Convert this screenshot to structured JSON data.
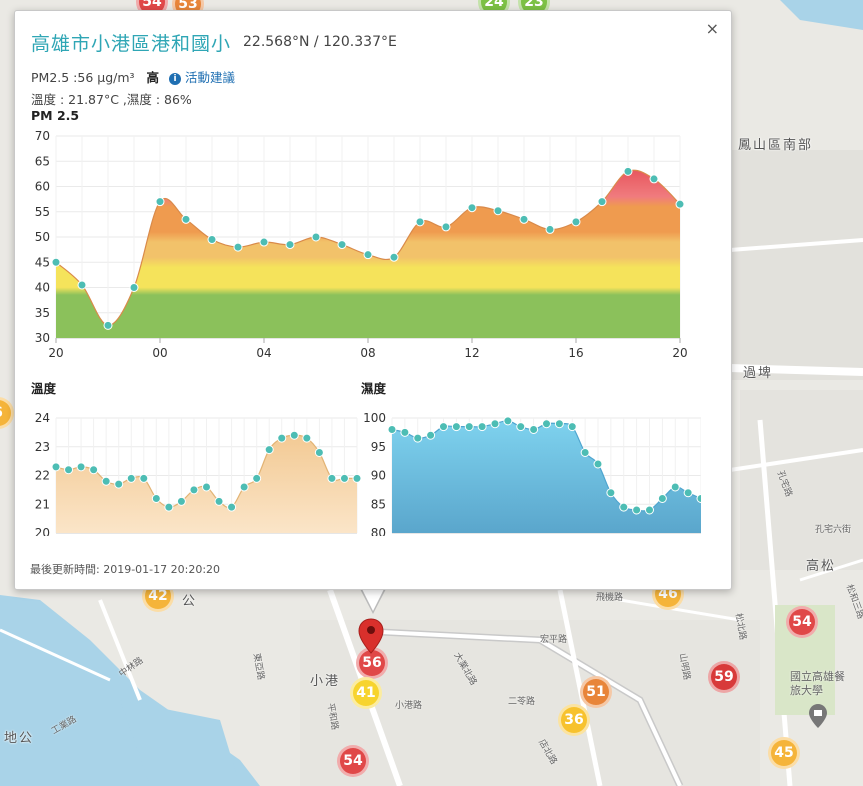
{
  "popup": {
    "close_label": "×",
    "station_name": "高雄市小港區港和國小",
    "coords": "22.568°N / 120.337°E",
    "pm_text": "PM2.5 :56 μg/m³",
    "pm_level": "高",
    "info_glyph": "i",
    "advice_label": "活動建議",
    "temp_humidity_text": "溫度 : 21.87°C ,濕度 : 86%",
    "updated_label": "最後更新時間:",
    "updated_value": "2019-01-17 20:20:20"
  },
  "map": {
    "labels": [
      "鳳山區南部",
      "過埤",
      "高松",
      "小港",
      "地公",
      "公"
    ],
    "small_labels": [
      "中林路",
      "宏平路",
      "二苓路",
      "大業北路",
      "平和路",
      "東亞路",
      "小港路",
      "店北路",
      "孔宅路",
      "孔宅六街",
      "山明路",
      "松北路",
      "飛機路",
      "松和三路",
      "工業路",
      "國立高雄餐旅大學"
    ],
    "markers": [
      {
        "label": "54",
        "color": "#e04848"
      },
      {
        "label": "53",
        "color": "#e8853a"
      },
      {
        "label": "24",
        "color": "#7cc144"
      },
      {
        "label": "23",
        "color": "#7cc144"
      },
      {
        "label": "42",
        "color": "#f5b43a"
      },
      {
        "label": "46",
        "color": "#f5b43a"
      },
      {
        "label": "54",
        "color": "#e04848"
      },
      {
        "label": "56",
        "color": "#e04848"
      },
      {
        "label": "41",
        "color": "#f7d42e"
      },
      {
        "label": "51",
        "color": "#e8853a"
      },
      {
        "label": "59",
        "color": "#d83a3a"
      },
      {
        "label": "36",
        "color": "#f7c22e"
      },
      {
        "label": "54",
        "color": "#e04848"
      },
      {
        "label": "45",
        "color": "#f5b43a"
      },
      {
        "label": "6",
        "color": "#f5b43a"
      }
    ]
  },
  "chart_data": [
    {
      "type": "area",
      "title": "PM 2.5",
      "ylim": [
        30,
        70
      ],
      "yticks": [
        30,
        35,
        40,
        45,
        50,
        55,
        60,
        65,
        70
      ],
      "xticks": [
        "20",
        "00",
        "04",
        "08",
        "12",
        "16",
        "20"
      ],
      "x": [
        20,
        21,
        22,
        23,
        0,
        1,
        2,
        3,
        4,
        5,
        6,
        7,
        8,
        9,
        10,
        11,
        12,
        13,
        14,
        15,
        16,
        17,
        18,
        19,
        20
      ],
      "values": [
        45,
        40.5,
        32.5,
        40,
        57,
        53.5,
        49.5,
        48,
        49,
        48.5,
        50,
        48.5,
        46.5,
        46,
        53,
        52,
        55.8,
        55.2,
        53.5,
        51.5,
        53,
        57,
        63,
        61.5,
        56.5
      ],
      "grid": true,
      "colors": {
        "line": "#4dbdb4",
        "green": "#8bc15b",
        "yellow": "#f5e35b",
        "orange": "#f2c26a",
        "dark_orange": "#ef9b4f",
        "red": "#e6525a"
      }
    },
    {
      "type": "area",
      "title": "溫度",
      "ylim": [
        20,
        24
      ],
      "yticks": [
        20,
        21,
        22,
        23,
        24
      ],
      "values": [
        22.3,
        22.2,
        22.3,
        22.2,
        21.8,
        21.7,
        21.9,
        21.9,
        21.2,
        20.9,
        21.1,
        21.5,
        21.6,
        21.1,
        20.9,
        21.6,
        21.9,
        22.9,
        23.3,
        23.4,
        23.3,
        22.8,
        21.9,
        21.9,
        21.9
      ],
      "grid": true,
      "colors": {
        "line": "#4dbdb4",
        "fill_top": "#f1c58b",
        "fill_bottom": "#fbe5c8"
      }
    },
    {
      "type": "area",
      "title": "濕度",
      "ylim": [
        80,
        100
      ],
      "yticks": [
        80,
        85,
        90,
        95,
        100
      ],
      "values": [
        98,
        97.5,
        96.5,
        97,
        98.5,
        98.5,
        98.5,
        98.5,
        99,
        99.5,
        98.5,
        98,
        99,
        99,
        98.5,
        94,
        92,
        87,
        84.5,
        84,
        84,
        86,
        88,
        87,
        86
      ],
      "grid": true,
      "colors": {
        "line": "#4dbdb4",
        "fill_top": "#7fd3ef",
        "fill_bottom": "#5aa6cc"
      }
    }
  ]
}
